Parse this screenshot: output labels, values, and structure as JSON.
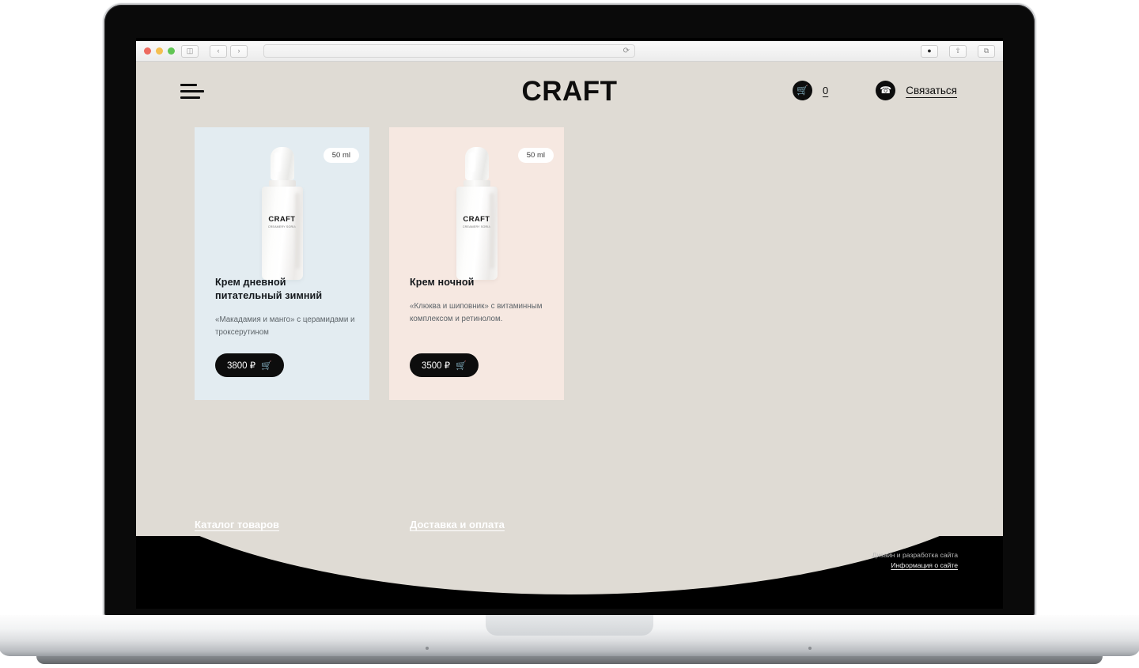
{
  "browser": {
    "address_value": "",
    "address_placeholder": "",
    "reload_icon": "reload-icon",
    "sidebar_icon": "sidebar-toggle-icon",
    "back_icon": "‹",
    "forward_icon": "›",
    "download_icon": "⬇",
    "share_icon": "↑",
    "tabs_icon": "⧉"
  },
  "header": {
    "brand": "CRAFT",
    "menu_icon": "hamburger-menu-icon",
    "cart_icon": "shopping-cart-icon",
    "cart_count": "0",
    "phone_icon": "phone-icon",
    "contact_label": "Связаться"
  },
  "products": [
    {
      "badge": "50 ml",
      "title": "Крем дневной питательный зимний",
      "description": "«Макадамия и манго» с церамидами и троксерутином",
      "price": "3800 ₽",
      "bottle_label": "CRAFT",
      "bottle_sub": "CREAMERY SORIA",
      "bg": "#e3ecf1"
    },
    {
      "badge": "50 ml",
      "title": "Крем ночной",
      "description": "«Клюква и шиповник» с витаминным комплексом и ретинолом.",
      "price": "3500 ₽",
      "bottle_label": "CRAFT",
      "bottle_sub": "CREAMERY SORIA",
      "bg": "#f6e8e1"
    }
  ],
  "footer": {
    "links": [
      {
        "label": "Каталог товаров"
      },
      {
        "label": "Доставка и оплата"
      }
    ],
    "credit_text": "Дизайн и разработка сайта",
    "credit_link": "Информация о сайте"
  },
  "colors": {
    "page_bg": "#dfdbd4",
    "footer_bg": "#000000",
    "accent_dark": "#0d0d0d"
  }
}
